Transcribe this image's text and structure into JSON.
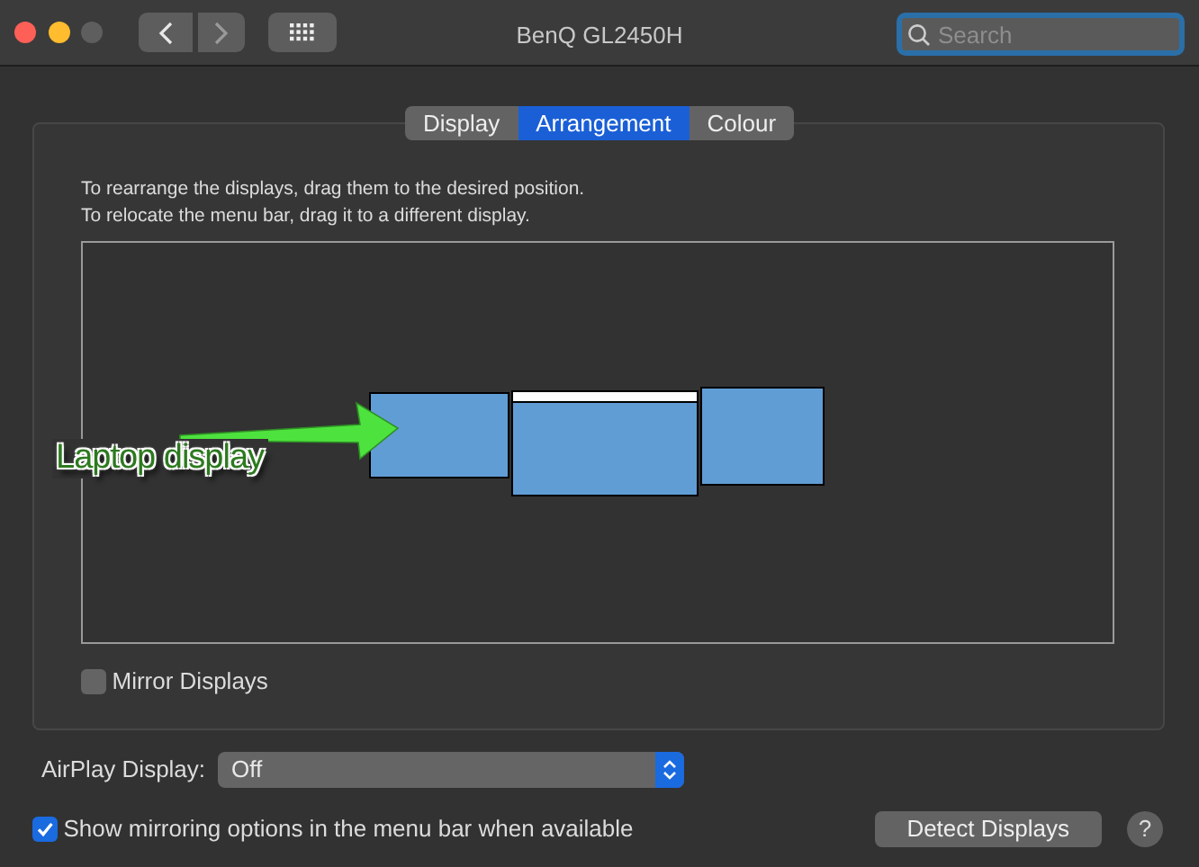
{
  "window": {
    "title": "BenQ GL2450H"
  },
  "search": {
    "placeholder": "Search"
  },
  "tabs": [
    {
      "label": "Display",
      "selected": false
    },
    {
      "label": "Arrangement",
      "selected": true
    },
    {
      "label": "Colour",
      "selected": false
    }
  ],
  "instructions": [
    "To rearrange the displays, drag them to the desired position.",
    "To relocate the menu bar, drag it to a different display."
  ],
  "displays": [
    {
      "menu_bar": false
    },
    {
      "menu_bar": true
    },
    {
      "menu_bar": false
    }
  ],
  "annotation": {
    "label": "Laptop display"
  },
  "mirror": {
    "label": "Mirror Displays",
    "checked": false
  },
  "airplay": {
    "label": "AirPlay Display:",
    "value": "Off"
  },
  "show_mirroring": {
    "label": "Show mirroring options in the menu bar when available",
    "checked": true
  },
  "buttons": [
    {
      "label": "Detect Displays",
      "kind": "push"
    },
    {
      "label": "?",
      "kind": "help"
    }
  ]
}
